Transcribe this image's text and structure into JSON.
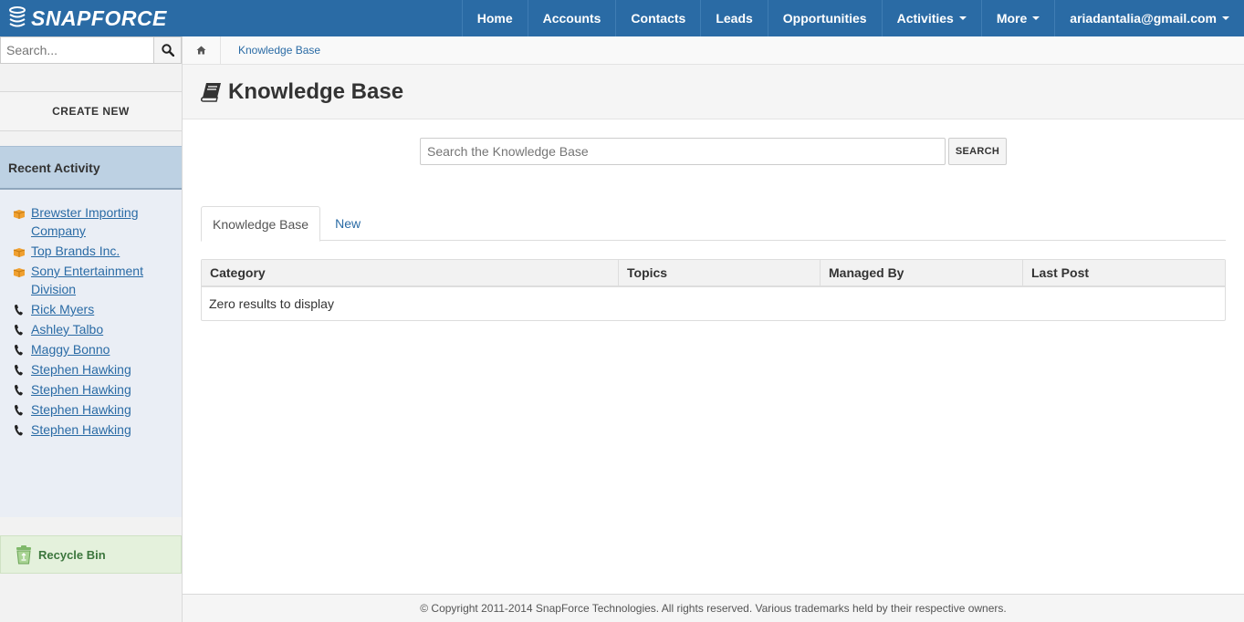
{
  "app": {
    "logo_text": "SNAPFORCE"
  },
  "nav": {
    "items": [
      {
        "label": "Home"
      },
      {
        "label": "Accounts"
      },
      {
        "label": "Contacts"
      },
      {
        "label": "Leads"
      },
      {
        "label": "Opportunities"
      },
      {
        "label": "Activities",
        "dropdown": true
      },
      {
        "label": "More",
        "dropdown": true
      },
      {
        "label": "ariadantalia@gmail.com",
        "dropdown": true
      }
    ]
  },
  "sidebar": {
    "search_placeholder": "Search...",
    "create_new": "CREATE NEW",
    "recent_header": "Recent Activity",
    "recent_items": [
      {
        "label": "Brewster Importing Company",
        "icon": "account-icon"
      },
      {
        "label": "Top Brands Inc.",
        "icon": "account-icon"
      },
      {
        "label": "Sony Entertainment Division",
        "icon": "account-icon"
      },
      {
        "label": "Rick Myers",
        "icon": "phone-icon"
      },
      {
        "label": "Ashley Talbo",
        "icon": "phone-icon"
      },
      {
        "label": "Maggy Bonno",
        "icon": "phone-icon"
      },
      {
        "label": "Stephen Hawking",
        "icon": "phone-icon"
      },
      {
        "label": "Stephen Hawking",
        "icon": "phone-icon"
      },
      {
        "label": "Stephen Hawking",
        "icon": "phone-icon"
      },
      {
        "label": "Stephen Hawking",
        "icon": "phone-icon"
      }
    ],
    "recycle_bin": "Recycle Bin"
  },
  "breadcrumb": {
    "current": "Knowledge Base"
  },
  "page": {
    "title": "Knowledge Base",
    "search_placeholder": "Search the Knowledge Base",
    "search_button": "SEARCH",
    "tabs": [
      {
        "label": "Knowledge Base",
        "active": true
      },
      {
        "label": "New",
        "active": false
      }
    ],
    "grid": {
      "columns": [
        "Category",
        "Topics",
        "Managed By",
        "Last Post"
      ],
      "empty_message": "Zero results to display"
    }
  },
  "footer": {
    "text": "© Copyright 2011-2014 SnapForce Technologies. All rights reserved. Various trademarks held by their respective owners."
  },
  "colors": {
    "navbar": "#2a6ba5",
    "link": "#2a6ba5",
    "recent_header": "#bdd1e3",
    "recycle_bg": "#e4f1dc"
  }
}
